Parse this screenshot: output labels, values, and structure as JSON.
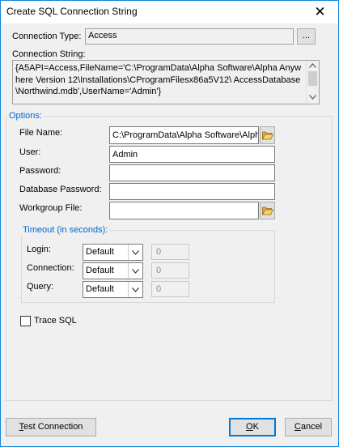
{
  "window": {
    "title": "Create SQL Connection String",
    "close_glyph": "✕"
  },
  "connection_type": {
    "label": "Connection Type:",
    "value": "Access",
    "browse_label": "..."
  },
  "connection_string": {
    "label": "Connection String:",
    "value": "{A5API=Access,FileName='C:\\ProgramData\\Alpha Software\\Alpha Anywhere Version 12\\Installations\\CProgramFilesx86a5V12\\ AccessDatabase\\Northwind.mdb',UserName='Admin'}"
  },
  "options": {
    "title": "Options:",
    "file_name": {
      "label": "File Name:",
      "value": "C:\\ProgramData\\Alpha Software\\Alpha"
    },
    "user": {
      "label": "User:",
      "value": "Admin"
    },
    "password": {
      "label": "Password:",
      "value": ""
    },
    "database_password": {
      "label": "Database Password:",
      "value": ""
    },
    "workgroup_file": {
      "label": "Workgroup File:",
      "value": ""
    }
  },
  "timeout": {
    "title": "Timeout (in seconds):",
    "rows": [
      {
        "label": "Login:",
        "mode": "Default",
        "value": "0"
      },
      {
        "label": "Connection:",
        "mode": "Default",
        "value": "0"
      },
      {
        "label": "Query:",
        "mode": "Default",
        "value": "0"
      }
    ]
  },
  "trace_sql": {
    "label": "Trace SQL",
    "checked": false
  },
  "buttons": {
    "test_connection": {
      "mnemonic": "T",
      "rest": "est Connection"
    },
    "ok": {
      "mnemonic": "O",
      "rest": "K"
    },
    "cancel": {
      "mnemonic": "C",
      "rest": "ancel"
    }
  },
  "colors": {
    "accent": "#0078d7",
    "group_title": "#0066cc",
    "folder": "#e8b03a"
  },
  "icons": [
    "close-icon",
    "folder-open-icon",
    "chevron-down-icon",
    "scroll-up-icon",
    "scroll-down-icon"
  ]
}
